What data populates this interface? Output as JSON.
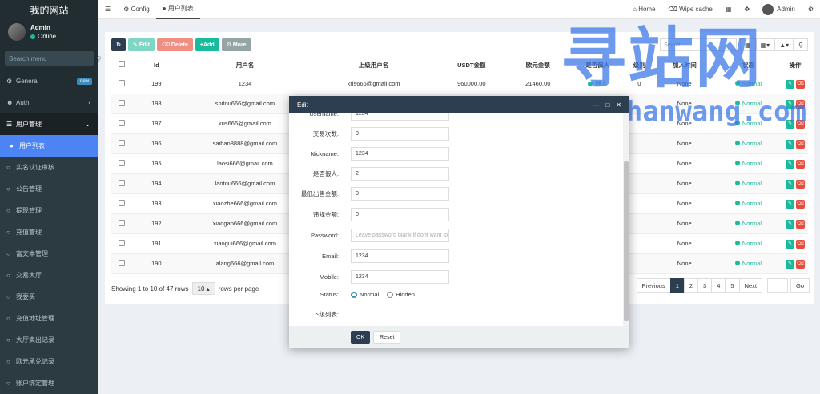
{
  "brand": "我的网站",
  "user": {
    "name": "Admin",
    "status": "Online"
  },
  "sidebar": {
    "search_placeholder": "Search menu",
    "items": [
      {
        "label": "General",
        "badge": "new"
      },
      {
        "label": "Auth"
      },
      {
        "label": "用户管理"
      },
      {
        "label": "用户列表"
      },
      {
        "label": "实名认证审核"
      },
      {
        "label": "公告管理"
      },
      {
        "label": "提现管理"
      },
      {
        "label": "充值管理"
      },
      {
        "label": "富文本管理"
      },
      {
        "label": "交易大厅"
      },
      {
        "label": "我要买"
      },
      {
        "label": "充值地址管理"
      },
      {
        "label": "大厅卖出记录"
      },
      {
        "label": "欧元承兑记录"
      },
      {
        "label": "账户绑定管理"
      }
    ]
  },
  "topbar": {
    "tabs": [
      "Config",
      "用户列表"
    ],
    "home": "Home",
    "wipe_cache": "Wipe cache",
    "admin": "Admin"
  },
  "toolbar": {
    "edit": "Edit",
    "delete": "Delete",
    "add": "Add",
    "more": "More",
    "search_placeholder": "Search"
  },
  "table": {
    "headers": [
      "Id",
      "用户名",
      "上级用户名",
      "USDT金额",
      "欧元金额",
      "是否假人",
      "级别",
      "加入时间",
      "状态",
      "操作"
    ],
    "rows": [
      {
        "id": "199",
        "username": "1234",
        "parent": "kris666@gmail.com",
        "usdt": "960000.00",
        "euro": "21460.00",
        "fake": "假人",
        "level": "0",
        "join": "None",
        "status": "Normal"
      },
      {
        "id": "198",
        "username": "shitou666@gmail.com",
        "join": "None",
        "status": "Normal"
      },
      {
        "id": "197",
        "username": "kris666@gmail.com",
        "join": "None",
        "status": "Normal"
      },
      {
        "id": "196",
        "username": "saiban8888@gmail.com",
        "join": "None",
        "status": "Normal"
      },
      {
        "id": "195",
        "username": "laosi666@gmail.com",
        "join": "None",
        "status": "Normal"
      },
      {
        "id": "194",
        "username": "laotou666@gmail.com",
        "join": "None",
        "status": "Normal"
      },
      {
        "id": "193",
        "username": "xiaozhe666@gmail.com",
        "join": "None",
        "status": "Normal"
      },
      {
        "id": "192",
        "username": "xiaogao666@gmail.com",
        "join": "None",
        "status": "Normal"
      },
      {
        "id": "191",
        "username": "xiaogui666@gmail.com",
        "join": "None",
        "status": "Normal"
      },
      {
        "id": "190",
        "username": "alang666@gmail.com",
        "join": "None",
        "status": "Normal"
      }
    ]
  },
  "footer": {
    "showing": "Showing 1 to 10 of 47 rows",
    "page_size": "10",
    "per_page": "rows per page"
  },
  "pager": {
    "prev": "Previous",
    "pages": [
      "1",
      "2",
      "3",
      "4",
      "5"
    ],
    "next": "Next",
    "go": "Go"
  },
  "modal": {
    "title": "Edit",
    "fields": [
      {
        "label": "Username:",
        "value": "1234"
      },
      {
        "label": "交易次数:",
        "value": "0"
      },
      {
        "label": "Nickname:",
        "value": "1234"
      },
      {
        "label": "是否假人:",
        "value": "2"
      },
      {
        "label": "最低出售金额:",
        "value": "0"
      },
      {
        "label": "违规金额:",
        "value": "0"
      },
      {
        "label": "Password:",
        "value": "",
        "placeholder": "Leave password blank if dont want to change"
      },
      {
        "label": "Email:",
        "value": "1234"
      },
      {
        "label": "Mobile:",
        "value": "1234"
      }
    ],
    "status_label": "Status:",
    "status_options": [
      "Normal",
      "Hidden"
    ],
    "sub_list_label": "下级列表:",
    "ok": "OK",
    "reset": "Reset"
  },
  "watermark": {
    "cn": "寻站网",
    "en": "xunzhanwang.com"
  }
}
